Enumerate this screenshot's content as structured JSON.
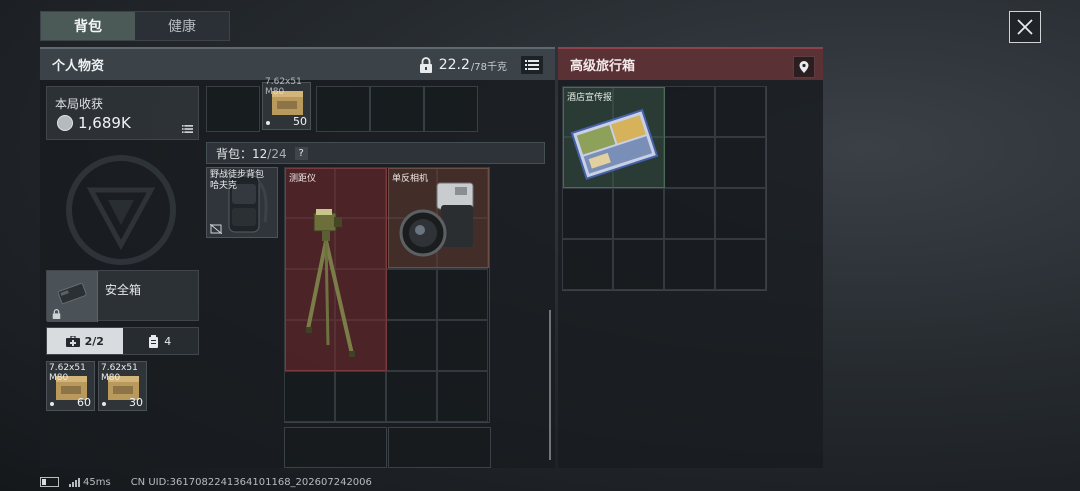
{
  "tabs": [
    {
      "label": "背包"
    },
    {
      "label": "健康"
    }
  ],
  "left_panel": {
    "title": "个人物资",
    "weight_current": "22.2",
    "weight_max": "/78千克",
    "round_gain": {
      "label": "本局收获",
      "value": "1,689K"
    },
    "safe_box": {
      "label": "安全箱"
    },
    "capacity_tabs": [
      {
        "value": "2/2"
      },
      {
        "value": "4"
      }
    ],
    "safe_items": [
      {
        "label": "7.62x51\nM80",
        "count": "60"
      },
      {
        "label": "7.62x51\nM80",
        "count": "30"
      }
    ],
    "top_item": {
      "label": "7.62x51\nM80",
      "count": "50"
    },
    "bag": {
      "label": "背包：",
      "used": "12",
      "total": "/24",
      "help": "?"
    },
    "backpack_item": {
      "label": "野战徒步背包\n哈夫克"
    },
    "items": [
      {
        "label": "测距仪"
      },
      {
        "label": "单反相机"
      }
    ]
  },
  "right_panel": {
    "title": "高级旅行箱",
    "items": [
      {
        "label": "酒店宣传报"
      }
    ]
  },
  "status_bar": {
    "ping": "45ms",
    "uid": "CN UID:3617082241364101168_202607242006"
  },
  "colors": {
    "tab_active": "#4c5a57",
    "right_header": "#5a3236",
    "rangefinder_bg": "#782a2e",
    "camera_bg": "#5f3a30",
    "case_item_bg": "#3a5a48"
  },
  "icons": [
    "close-icon",
    "lock-icon",
    "list-icon",
    "location-pin-icon",
    "coin-icon",
    "medkit-icon",
    "ammo-icon",
    "signal-icon",
    "battery-icon"
  ]
}
